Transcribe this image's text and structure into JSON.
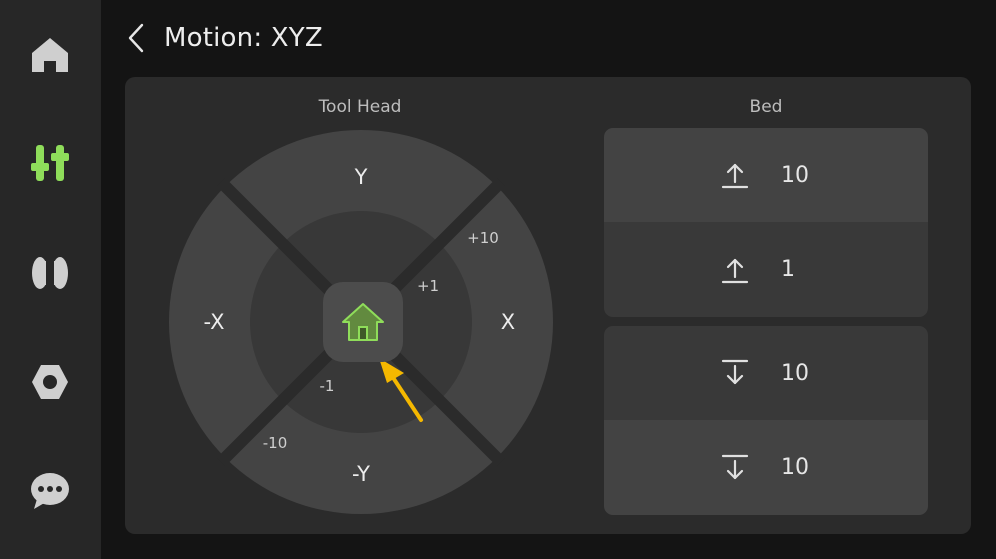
{
  "sidebar": {
    "items": [
      {
        "icon": "home-icon",
        "active": false
      },
      {
        "icon": "sliders-icon",
        "active": true
      },
      {
        "icon": "filament-spool-icon",
        "active": false
      },
      {
        "icon": "hex-nut-settings-icon",
        "active": false
      },
      {
        "icon": "chat-bubble-icon",
        "active": false
      }
    ]
  },
  "header": {
    "back_icon": "chevron-left-icon",
    "title": "Motion: XYZ"
  },
  "tool_head": {
    "label": "Tool Head",
    "y_plus": "Y",
    "y_minus": "-Y",
    "x_plus": "X",
    "x_minus": "-X",
    "step_outer_plus": "+10",
    "step_inner_plus": "+1",
    "step_inner_minus": "-1",
    "step_outer_minus": "-10",
    "home_icon": "home-icon"
  },
  "bed": {
    "label": "Bed",
    "buttons": [
      {
        "direction": "up",
        "icon": "arrow-up-to-line-icon",
        "value": "10"
      },
      {
        "direction": "up",
        "icon": "arrow-up-to-line-icon",
        "value": "1"
      },
      {
        "direction": "down",
        "icon": "arrow-down-from-line-icon",
        "value": "10"
      },
      {
        "direction": "down",
        "icon": "arrow-down-from-line-icon",
        "value": "10"
      }
    ]
  },
  "colors": {
    "accent": "#8fdd5a",
    "background": "#141414",
    "sidebar": "#272727",
    "panel": "#2b2b2b",
    "pad_outer": "#444444",
    "pad_inner": "#383838",
    "pointer": "#f5b800"
  }
}
